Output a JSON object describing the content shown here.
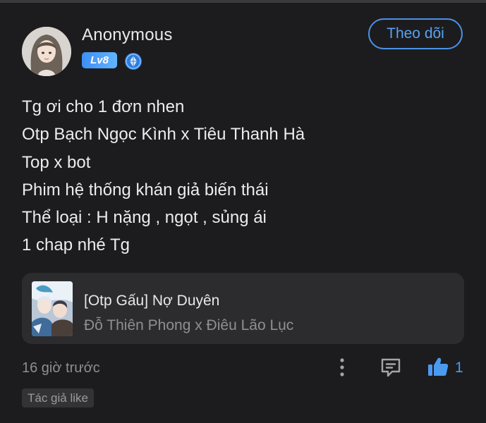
{
  "comment": {
    "username": "Anonymous",
    "level": "Lv8",
    "follow_label": "Theo dõi",
    "lines": [
      "Tg ơi cho 1 đơn nhen",
      "Otp Bạch Ngọc Kình x Tiêu Thanh Hà",
      "Top x bot",
      "Phim hệ thống khán giả biến thái",
      "Thể loại : H nặng , ngọt , sủng ái",
      "1 chap nhé Tg"
    ],
    "linked_story": {
      "title": "[Otp Gấu] Nợ Duyên",
      "subtitle": "Đỗ Thiên Phong x Điêu Lão Lục"
    },
    "timestamp": "16 giờ trước",
    "like_count": "1",
    "author_like_tag": "Tác giả like"
  },
  "icons": {
    "rank": "rank-diamond-icon",
    "more": "more-vertical-icon",
    "comment": "comment-icon",
    "like": "thumbs-up-icon"
  },
  "colors": {
    "background": "#1c1c1e",
    "accent": "#4b9af0",
    "level_badge": "#3d8ff4",
    "card": "#2c2c2e",
    "muted_text": "#8e8e92"
  }
}
